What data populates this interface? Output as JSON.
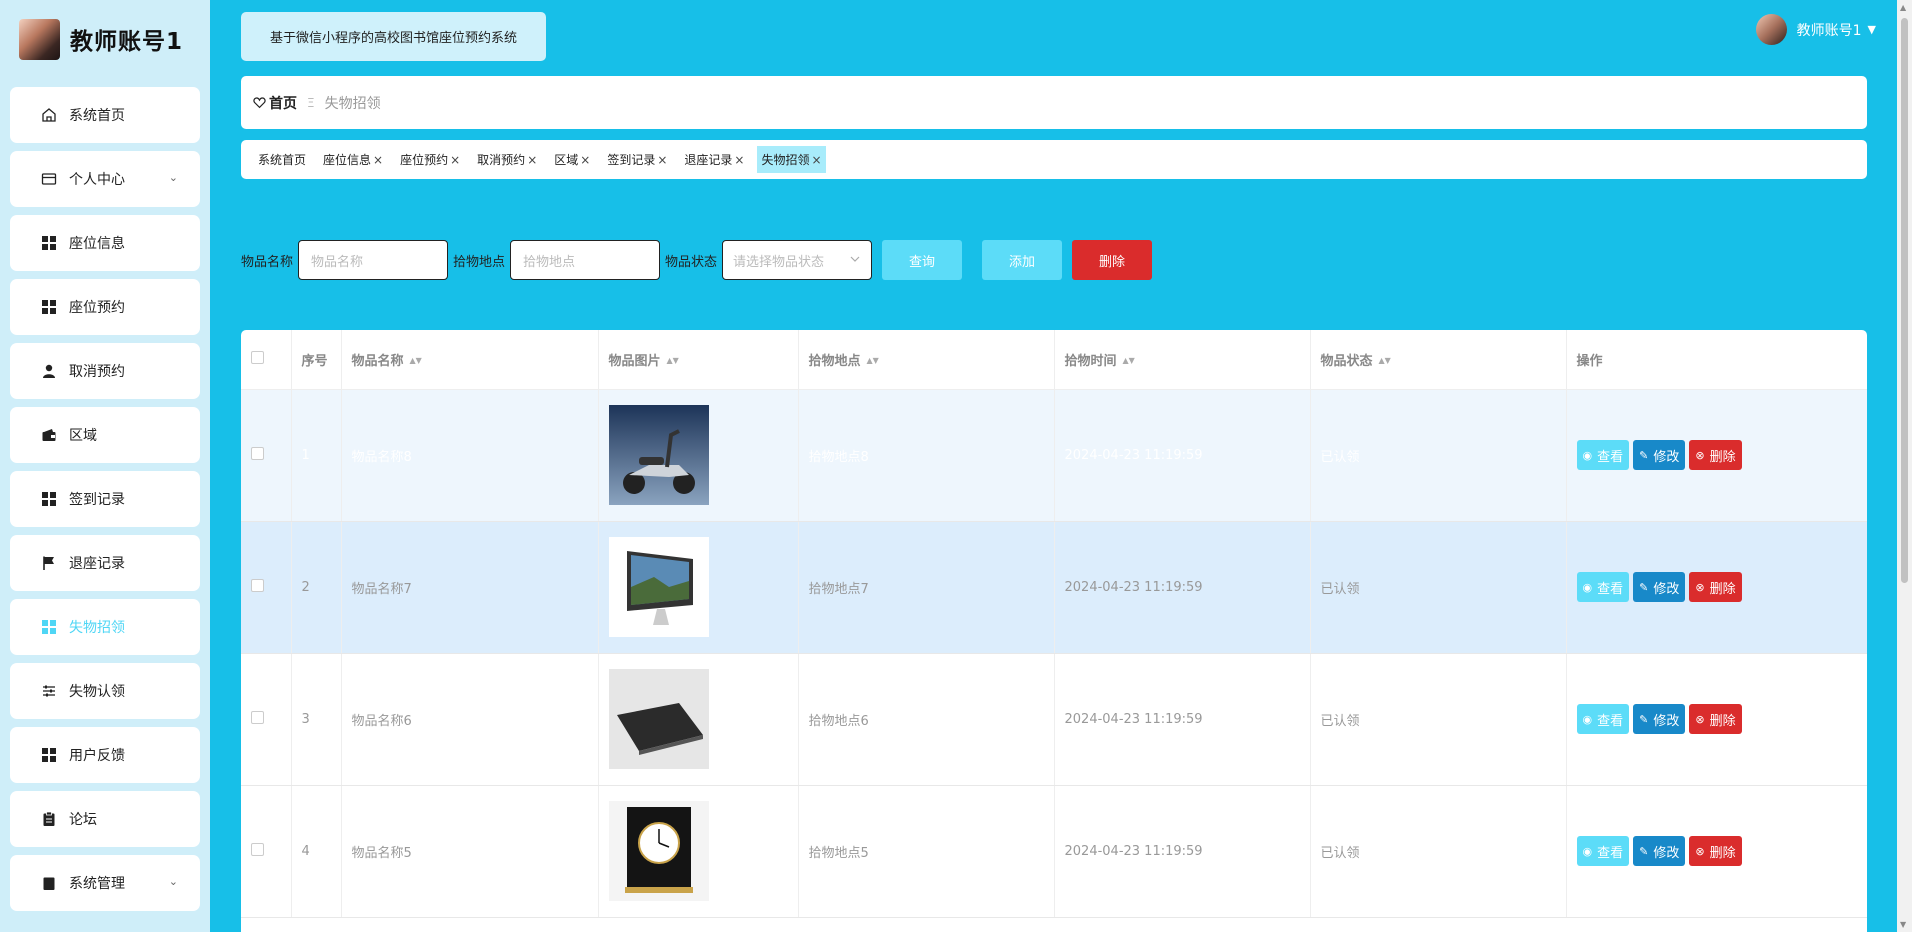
{
  "sidebar": {
    "account_name": "教师账号1",
    "items": [
      {
        "label": "系统首页",
        "icon": "home-icon"
      },
      {
        "label": "个人中心",
        "icon": "card-icon",
        "expand": "⌄"
      },
      {
        "label": "座位信息",
        "icon": "grid-icon"
      },
      {
        "label": "座位预约",
        "icon": "grid-icon"
      },
      {
        "label": "取消预约",
        "icon": "user-icon"
      },
      {
        "label": "区域",
        "icon": "wallet-icon"
      },
      {
        "label": "签到记录",
        "icon": "grid-icon"
      },
      {
        "label": "退座记录",
        "icon": "flag-icon"
      },
      {
        "label": "失物招领",
        "icon": "grid-icon",
        "active": true
      },
      {
        "label": "失物认领",
        "icon": "sliders-icon"
      },
      {
        "label": "用户反馈",
        "icon": "grid-icon"
      },
      {
        "label": "论坛",
        "icon": "clipboard-icon"
      },
      {
        "label": "系统管理",
        "icon": "clipboard-icon",
        "expand": "⌄"
      }
    ]
  },
  "header": {
    "system_title": "基于微信小程序的高校图书馆座位预约系统",
    "user_name": "教师账号1",
    "user_caret": "▼"
  },
  "breadcrumb": {
    "home": "首页",
    "separator": "Ξ",
    "current": "失物招领"
  },
  "tabs": [
    {
      "label": "系统首页",
      "closable": false
    },
    {
      "label": "座位信息",
      "closable": true
    },
    {
      "label": "座位预约",
      "closable": true
    },
    {
      "label": "取消预约",
      "closable": true
    },
    {
      "label": "区域",
      "closable": true
    },
    {
      "label": "签到记录",
      "closable": true
    },
    {
      "label": "退座记录",
      "closable": true
    },
    {
      "label": "失物招领",
      "closable": true,
      "active": true
    }
  ],
  "tab_close_glyph": "×",
  "search": {
    "name_label": "物品名称",
    "name_placeholder": "物品名称",
    "place_label": "拾物地点",
    "place_placeholder": "拾物地点",
    "status_label": "物品状态",
    "status_placeholder": "请选择物品状态",
    "query_button": "查询",
    "add_button": "添加",
    "delete_button": "删除"
  },
  "table": {
    "headers": [
      "序号",
      "物品名称",
      "物品图片",
      "拾物地点",
      "拾物时间",
      "物品状态",
      "操作"
    ],
    "sort_glyph": "▲▼",
    "actions": {
      "view": "查看",
      "edit": "修改",
      "delete": "删除"
    },
    "rows": [
      {
        "no": "1",
        "name": "物品名称8",
        "image": "scooter",
        "place": "拾物地点8",
        "time": "2024-04-23 11:19:59",
        "status": "已认领"
      },
      {
        "no": "2",
        "name": "物品名称7",
        "image": "imac",
        "place": "拾物地点7",
        "time": "2024-04-23 11:19:59",
        "status": "已认领"
      },
      {
        "no": "3",
        "name": "物品名称6",
        "image": "laptop",
        "place": "拾物地点6",
        "time": "2024-04-23 11:19:59",
        "status": "已认领"
      },
      {
        "no": "4",
        "name": "物品名称5",
        "image": "clock",
        "place": "拾物地点5",
        "time": "2024-04-23 11:19:59",
        "status": "已认领"
      }
    ]
  },
  "colors": {
    "page_bg": "#17bfe8",
    "sidebar_bg": "#cfeef9",
    "accent": "#5cdcf8",
    "edit": "#1889c9",
    "danger": "#da2c2c"
  }
}
